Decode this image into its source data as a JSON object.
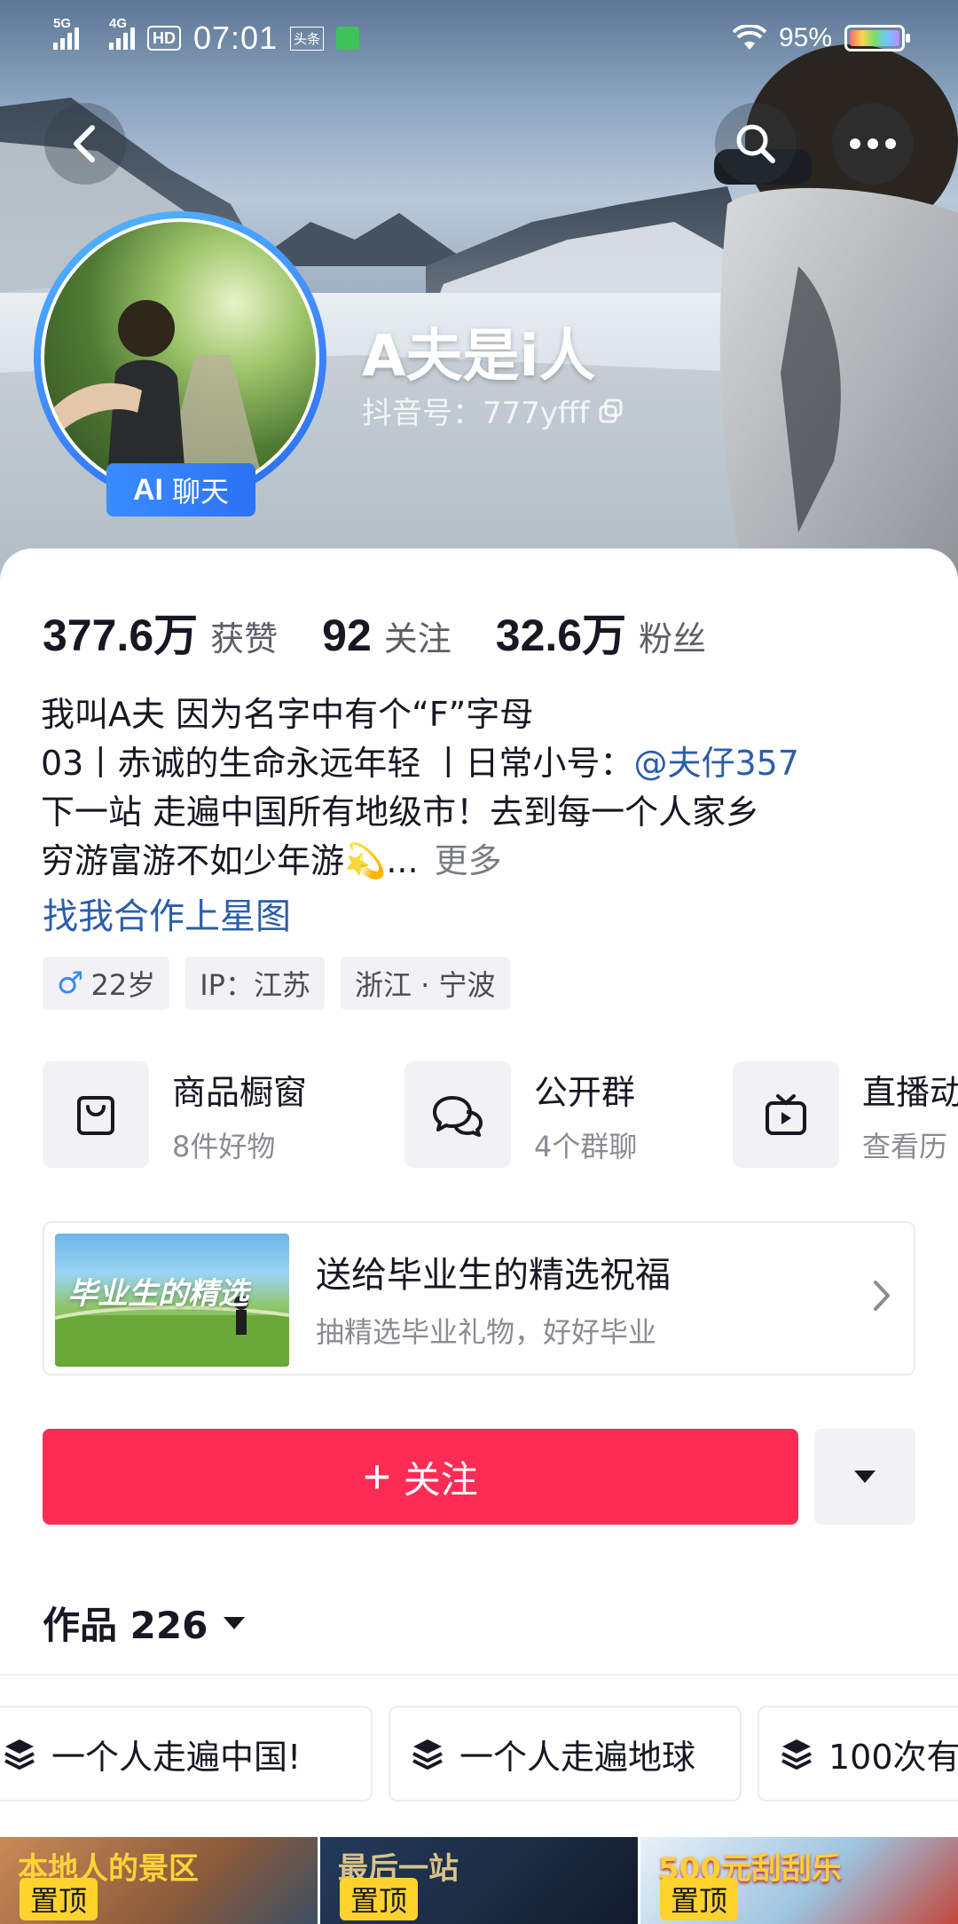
{
  "status_bar": {
    "net1": "5G",
    "net2": "4G",
    "hd": "HD",
    "time": "07:01",
    "app_badge": "头条",
    "battery": "95%"
  },
  "profile": {
    "nickname": "A夫是i人",
    "douyin_id": "抖音号：777yfff",
    "ai_badge_icon": "AI",
    "ai_badge_label": "聊天"
  },
  "stats": [
    {
      "value": "377.6万",
      "label": "获赞"
    },
    {
      "value": "92",
      "label": "关注"
    },
    {
      "value": "32.6万",
      "label": "粉丝"
    }
  ],
  "bio": {
    "line1": "我叫A夫 因为名字中有个“F”字母",
    "line2_prefix": "03丨赤诚的生命永远年轻 丨日常小号：",
    "line2_mention": "@夫仔357",
    "line3": "下一站  走遍中国所有地级市！去到每一个人家乡",
    "line4": "穷游富游不如少年游",
    "line4_emoji": "💫",
    "line4_ellipsis": "...",
    "more": "更多",
    "star_link": "找我合作上星图"
  },
  "tags": {
    "gender_age": "22岁",
    "ip": "IP：江苏",
    "location": "浙江 · 宁波"
  },
  "features": [
    {
      "title": "商品橱窗",
      "sub": "8件好物",
      "icon": "shopping-bag-icon"
    },
    {
      "title": "公开群",
      "sub": "4个群聊",
      "icon": "chat-bubbles-icon"
    },
    {
      "title": "直播动",
      "sub": "查看历",
      "icon": "tv-icon"
    }
  ],
  "promo": {
    "title": "送给毕业生的精选祝福",
    "subtitle": "抽精选毕业礼物，好好毕业",
    "thumb_text": "毕业生的精选"
  },
  "actions": {
    "follow": "关注",
    "plus": "+"
  },
  "works": {
    "label": "作品 226"
  },
  "collections": [
    "一个人走遍中国!",
    "一个人走遍地球",
    "100次有"
  ],
  "videos": [
    {
      "caption": "本地人的景区",
      "pin": "置顶"
    },
    {
      "caption": "最后一站",
      "pin": "置顶"
    },
    {
      "caption": "500元刮刮乐",
      "pin": "置顶"
    }
  ],
  "colors": {
    "follow_red": "#fe2c55",
    "link_blue": "#2b5ea8",
    "pin_yellow": "#ffd22e",
    "avatar_ring": "#3c83ff"
  }
}
